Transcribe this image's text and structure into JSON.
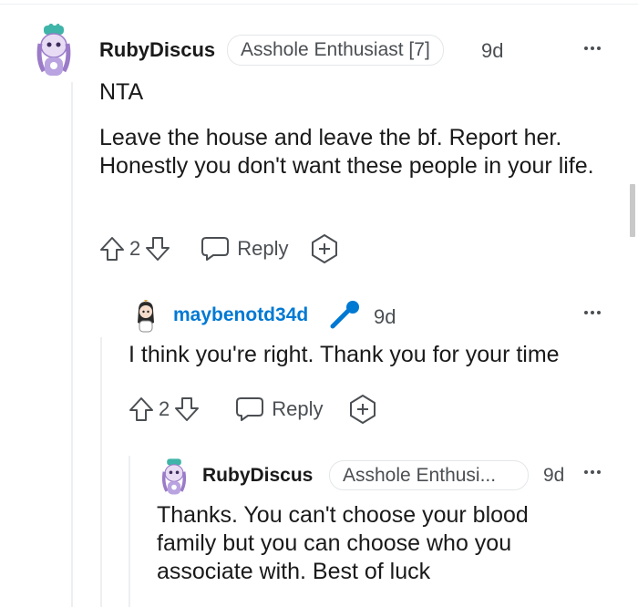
{
  "comments": [
    {
      "username": "RubyDiscus",
      "flair": "Asshole Enthusiast [7]",
      "time": "9d",
      "paragraphs": [
        "NTA",
        "Leave the house and leave the bf. Report her. Honestly you don't want these people in your life."
      ],
      "votes": "2",
      "reply_label": "Reply"
    },
    {
      "username": "maybenotd34d",
      "time": "9d",
      "paragraphs": [
        "I think you're right. Thank you for your time"
      ],
      "votes": "2",
      "reply_label": "Reply",
      "username_color": "#0079d3",
      "badge_icon": "microphone-icon"
    },
    {
      "username": "RubyDiscus",
      "flair": "Asshole Enthusi...",
      "time": "9d",
      "paragraphs": [
        "Thanks. You can't choose your blood family but you can choose who you associate with. Best of luck"
      ]
    }
  ],
  "colors": {
    "text": "#1a1a1b",
    "meta": "#4b4f53",
    "link_user": "#0079d3",
    "divider": "#edeff1"
  }
}
